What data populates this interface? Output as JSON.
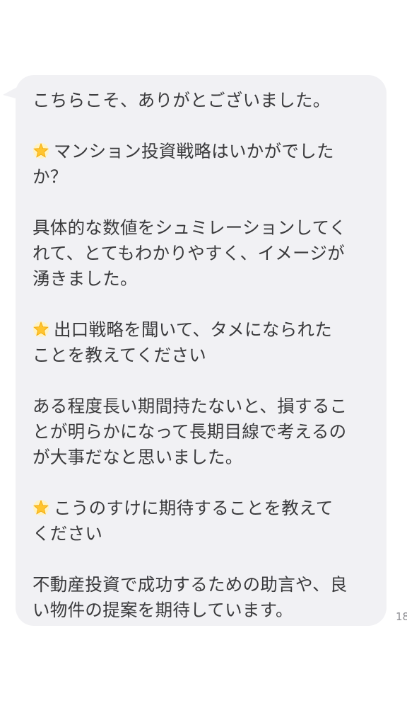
{
  "message": {
    "lines": [
      "こちらこそ、ありがとございました。",
      "",
      "マンション投資戦略はいかがでした",
      "か？",
      "",
      "具体的な数値をシュミレーションしてく",
      "れて、とてもわかりやすく、イメージが",
      "湧きました。",
      "",
      "出口戦略を聞いて、タメになられた",
      "ことを教えてください",
      "",
      "ある程度長い期間持たないと、損するこ",
      "とが明らかになって長期目線で考えるの",
      "が大事だなと思いました。",
      "",
      "こうのすけに期待することを教えて",
      "ください",
      "",
      "不動産投資で成功するための助言や、良",
      "い物件の提案を期待しています。"
    ],
    "timestamp_partial": "18",
    "bubble_color": "#f1f1f4",
    "star_icon": "glowing-star-icon"
  }
}
